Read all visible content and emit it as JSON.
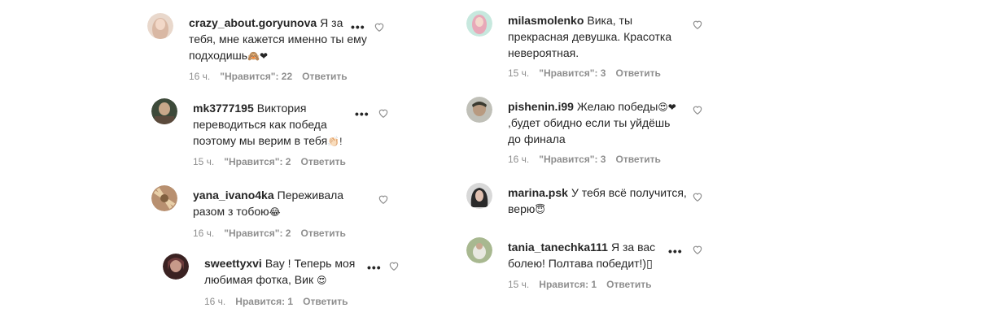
{
  "left": [
    {
      "user": "crazy_about.goryunova",
      "text": "Я за тебя, мне кажется именно ты ему подходишь",
      "emoji": "🙈❤",
      "time": "16 ч.",
      "likes": "\"Нравится\": 22",
      "reply": "Ответить",
      "avatar": "#d9b8a4"
    },
    {
      "user": "mk3777195",
      "text": "Виктория переводиться как победа поэтому мы верим в тебя",
      "emoji": "👏🏻!",
      "time": "15 ч.",
      "likes": "\"Нравится\": 2",
      "reply": "Ответить",
      "avatar": "#5b4a3c"
    },
    {
      "user": "yana_ivano4ka",
      "text": "Переживала разом з тобою",
      "emoji": "😂",
      "time": "16 ч.",
      "likes": "\"Нравится\": 2",
      "reply": "Ответить",
      "avatar": "#a08060"
    },
    {
      "user": "sweettyxvi",
      "text": "Вау ! Теперь моя любимая фотка, Вик",
      "emoji": "😍",
      "time": "16 ч.",
      "likes": "Нравится: 1",
      "reply": "Ответить",
      "avatar": "#6b3a3a"
    }
  ],
  "right": [
    {
      "user": "milasmolenko",
      "text": "Вика, ты прекрасная девушка. Красотка невероятная.",
      "emoji": "",
      "time": "15 ч.",
      "likes": "\"Нравится\": 3",
      "reply": "Ответить",
      "avatar": "#9fd4c4"
    },
    {
      "user": "pishenin.i99",
      "text": "Желаю победы",
      "emoji": "😍❤",
      "text2": ",будет обидно если ты уйдёшь до финала",
      "time": "16 ч.",
      "likes": "\"Нравится\": 3",
      "reply": "Ответить",
      "avatar": "#7a7a70"
    },
    {
      "user": "marina.psk",
      "text": "У тебя всё получится, верю",
      "emoji": "😇",
      "time": "",
      "likes": "",
      "reply": "",
      "avatar": "#4a4a4a"
    },
    {
      "user": "tania_tanechka111",
      "text": "Я за вас болею! Полтава победит!)",
      "emoji": "▯",
      "time": "15 ч.",
      "likes": "Нравится: 1",
      "reply": "Ответить",
      "avatar": "#8aa070"
    }
  ],
  "colors": {
    "meta": "#8e8e8e",
    "heart_red": "#ed4956"
  },
  "icons": {
    "more": "more-dots-icon",
    "like": "heart-outline-icon"
  }
}
